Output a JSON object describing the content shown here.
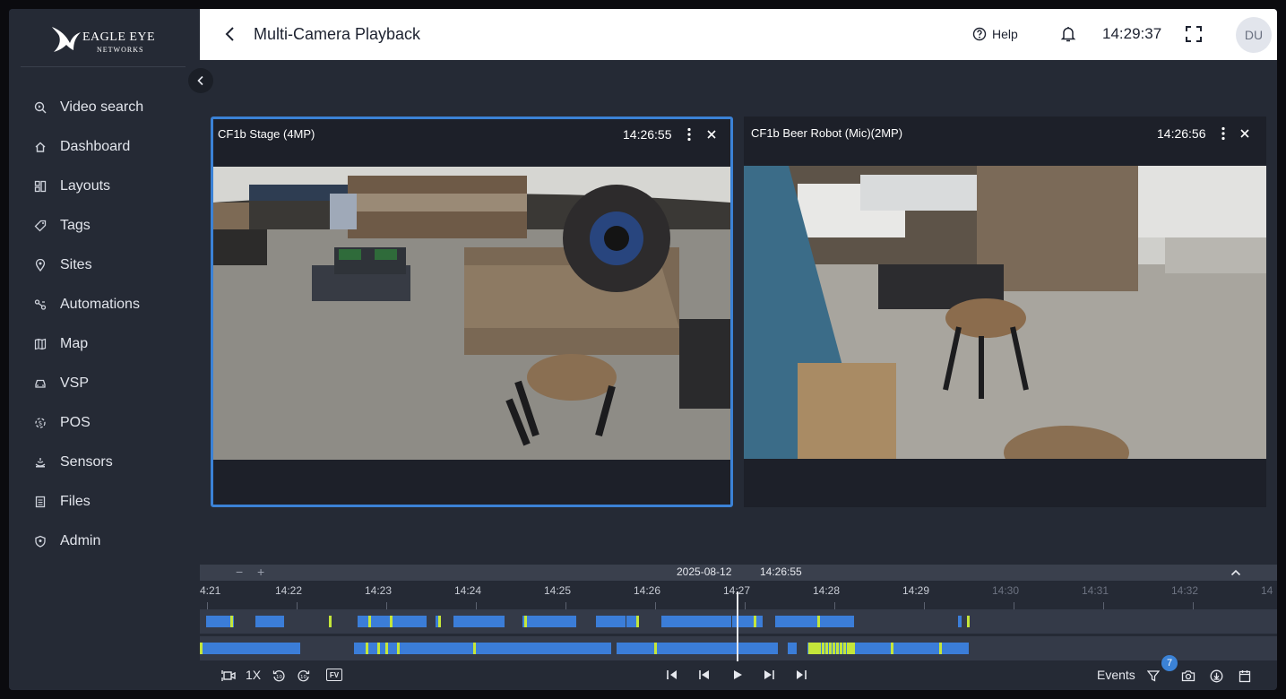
{
  "brand": {
    "name": "EAGLE EYE",
    "sub": "NETWORKS"
  },
  "sidebar": {
    "items": [
      {
        "label": "Video search",
        "icon": "search-video-icon"
      },
      {
        "label": "Dashboard",
        "icon": "home-icon"
      },
      {
        "label": "Layouts",
        "icon": "layouts-icon"
      },
      {
        "label": "Tags",
        "icon": "tag-icon"
      },
      {
        "label": "Sites",
        "icon": "location-pin-icon"
      },
      {
        "label": "Automations",
        "icon": "automations-icon"
      },
      {
        "label": "Map",
        "icon": "map-icon"
      },
      {
        "label": "VSP",
        "icon": "car-icon"
      },
      {
        "label": "POS",
        "icon": "pos-icon"
      },
      {
        "label": "Sensors",
        "icon": "sensor-icon"
      },
      {
        "label": "Files",
        "icon": "files-icon"
      },
      {
        "label": "Admin",
        "icon": "shield-icon"
      }
    ]
  },
  "header": {
    "title": "Multi-Camera Playback",
    "help_label": "Help",
    "clock": "14:29:37",
    "avatar_initials": "DU"
  },
  "cameras": [
    {
      "name": "CF1b Stage (4MP)",
      "time": "14:26:55",
      "selected": true
    },
    {
      "name": "CF1b Beer Robot (Mic)(2MP)",
      "time": "14:26:56",
      "selected": false
    }
  ],
  "timeline": {
    "date": "2025-08-12",
    "time": "14:26:55",
    "zoom_minus": "−",
    "zoom_plus": "+",
    "ticks": [
      "4:21",
      "14:22",
      "14:23",
      "14:24",
      "14:25",
      "14:26",
      "14:27",
      "14:28",
      "14:29",
      "14:30",
      "14:31",
      "14:32",
      "14"
    ],
    "future_from_index": 9
  },
  "controls": {
    "speed": "1X",
    "fv_label": "FV",
    "events_label": "Events",
    "events_count": "7"
  },
  "colors": {
    "accent": "#3b82d6",
    "segment": "#3b7dd8",
    "event": "#c4e63a"
  }
}
